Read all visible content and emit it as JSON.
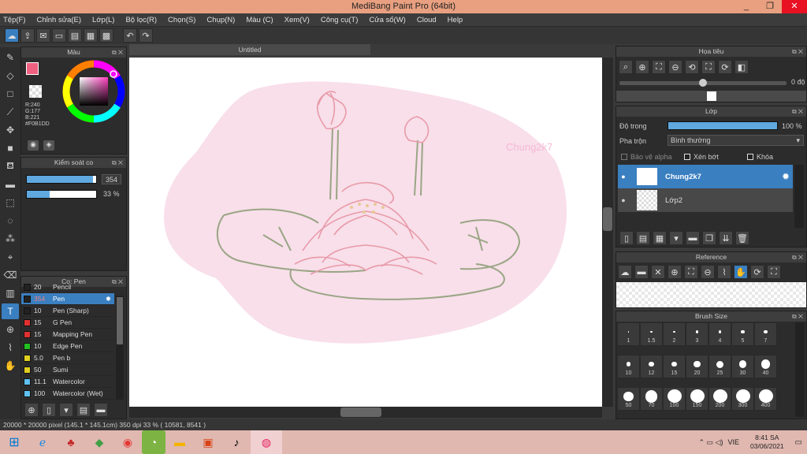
{
  "window": {
    "title": "MediBang Paint Pro (64bit)",
    "min": "_",
    "max": "❐",
    "close": "✕"
  },
  "menu": [
    "Tệp(F)",
    "Chỉnh sửa(E)",
    "Lớp(L)",
    "Bộ lọc(R)",
    "Chọn(S)",
    "Chụp(N)",
    "Màu (C)",
    "Xem(V)",
    "Công cụ(T)",
    "Cửa sổ(W)",
    "Cloud",
    "Help"
  ],
  "document": {
    "tab": "Untitled",
    "watermark": "Chung2k7"
  },
  "color_panel": {
    "title": "Màu",
    "r": "R:240",
    "g": "G:177",
    "b": "B:221",
    "hex": "#F0B1DD"
  },
  "brush_control": {
    "title": "Kiểm soát co",
    "size": "354",
    "opacity": "33 %",
    "size_fill": 0.96,
    "opacity_fill": 0.33
  },
  "brush_panel": {
    "title": "Co: Pen",
    "items": [
      {
        "size": "20",
        "name": "Pencil",
        "color": "#222222"
      },
      {
        "size": "354",
        "name": "Pen",
        "color": "#222222",
        "selected": true
      },
      {
        "size": "10",
        "name": "Pen (Sharp)",
        "color": "#222222"
      },
      {
        "size": "15",
        "name": "G Pen",
        "color": "#e03030"
      },
      {
        "size": "15",
        "name": "Mapping Pen",
        "color": "#e03030"
      },
      {
        "size": "10",
        "name": "Edge Pen",
        "color": "#20c020"
      },
      {
        "size": "5.0",
        "name": " Pen b",
        "color": "#e0d020"
      },
      {
        "size": "50",
        "name": "Sumi",
        "color": "#e0d020"
      },
      {
        "size": "11.1",
        "name": "Watercolor",
        "color": "#60c0f0"
      },
      {
        "size": "100",
        "name": "Watercolor (Wet)",
        "color": "#60c0f0"
      }
    ]
  },
  "navigator": {
    "title": "Họa tiêu",
    "zoom_value": "0 độ"
  },
  "layer_panel": {
    "title": "Lớp",
    "opacity_label": "Độ trong",
    "opacity_value": "100 %",
    "opacity_fill": 1.0,
    "blend_label": "Pha trộn",
    "blend_value": "Bình thường",
    "protect_alpha": "Bảo vệ alpha",
    "clip": "Xén bớt",
    "lock": "Khóa",
    "layers": [
      {
        "name": "Chung2k7",
        "selected": true
      },
      {
        "name": "Lớp2",
        "selected": false
      }
    ]
  },
  "reference": {
    "title": "Reference"
  },
  "brush_size": {
    "title": "Brush Size",
    "sizes": [
      "1",
      "1.5",
      "2",
      "3",
      "4",
      "5",
      "7",
      "10",
      "12",
      "15",
      "20",
      "25",
      "30",
      "40",
      "50",
      "70",
      "100",
      "150",
      "200",
      "300",
      "400"
    ]
  },
  "status": "20000 * 20000 pixel   (145.1 * 145.1cm)  350 dpi  33 %  ( 10581, 8541 )",
  "taskbar": {
    "lang": "VIE",
    "time": "8:41 SA",
    "date": "03/06/2021"
  }
}
